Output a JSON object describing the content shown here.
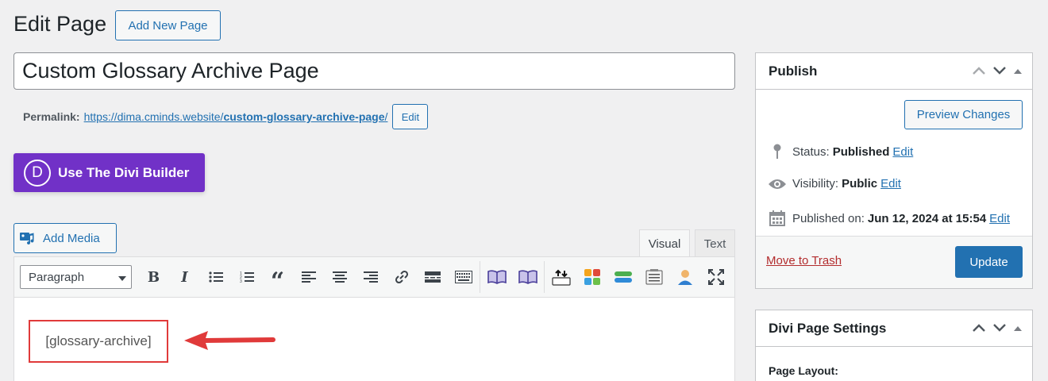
{
  "header": {
    "title": "Edit Page",
    "add_new_label": "Add New Page"
  },
  "post": {
    "title": "Custom Glossary Archive Page",
    "permalink_label": "Permalink:",
    "permalink_base": "https://dima.cminds.website/",
    "permalink_slug": "custom-glossary-archive-page",
    "permalink_trail": "/",
    "permalink_edit_label": "Edit"
  },
  "divi": {
    "logo_letter": "D",
    "button_label": "Use The Divi Builder"
  },
  "editor": {
    "add_media_label": "Add Media",
    "tabs": [
      {
        "label": "Visual",
        "active": true
      },
      {
        "label": "Text",
        "active": false
      }
    ],
    "format_select": "Paragraph",
    "content": "[glossary-archive]",
    "annotation_color": "#e03a3a"
  },
  "publish": {
    "title": "Publish",
    "preview_label": "Preview Changes",
    "status_label": "Status:",
    "status_value": "Published",
    "visibility_label": "Visibility:",
    "visibility_value": "Public",
    "published_label": "Published on:",
    "published_value": "Jun 12, 2024 at 15:54",
    "edit_label": "Edit",
    "trash_label": "Move to Trash",
    "update_label": "Update"
  },
  "divi_settings": {
    "title": "Divi Page Settings",
    "page_layout_label": "Page Layout:"
  },
  "colors": {
    "primary": "#2271b1",
    "divi_purple": "#7131c7",
    "danger": "#b32d2e"
  }
}
